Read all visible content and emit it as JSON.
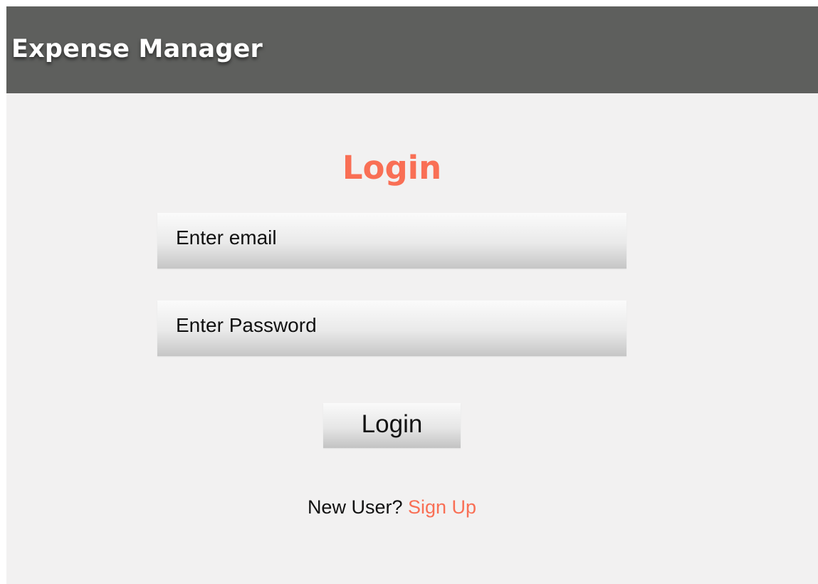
{
  "app_bar": {
    "title": "Expense Manager"
  },
  "login_form": {
    "heading": "Login",
    "email_field": {
      "value": "",
      "placeholder": "Enter email"
    },
    "password_field": {
      "value": "",
      "placeholder": "Enter Password"
    },
    "login_button_label": "Login",
    "signup_prompt": "New User?",
    "signup_link_label": "Sign Up"
  },
  "colors": {
    "app_bar_background": "#5e5f5d",
    "screen_background": "#f2f1f1",
    "accent": "#f96f55",
    "text": "#111111"
  }
}
